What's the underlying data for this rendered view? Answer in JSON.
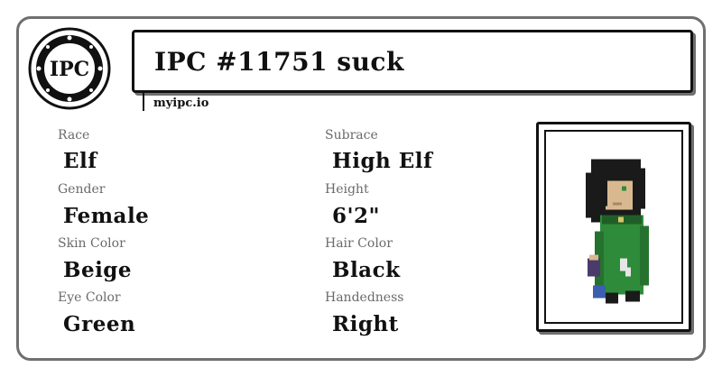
{
  "logo": {
    "text": "IPC"
  },
  "header": {
    "title": "IPC #11751 suck",
    "site": "myipc.io"
  },
  "fields": [
    {
      "label": "Race",
      "value": "Elf"
    },
    {
      "label": "Subrace",
      "value": "High Elf"
    },
    {
      "label": "Gender",
      "value": "Female"
    },
    {
      "label": "Height",
      "value": "6'2\""
    },
    {
      "label": "Skin Color",
      "value": "Beige"
    },
    {
      "label": "Hair Color",
      "value": "Black"
    },
    {
      "label": "Eye Color",
      "value": "Green"
    },
    {
      "label": "Handedness",
      "value": "Right"
    }
  ],
  "colors": {
    "border": "#6f6f6f",
    "ink": "#111111",
    "label": "#6a6a6a",
    "robe": "#2e8b3a",
    "hair": "#1a1a1a",
    "skin": "#d8b98f"
  }
}
